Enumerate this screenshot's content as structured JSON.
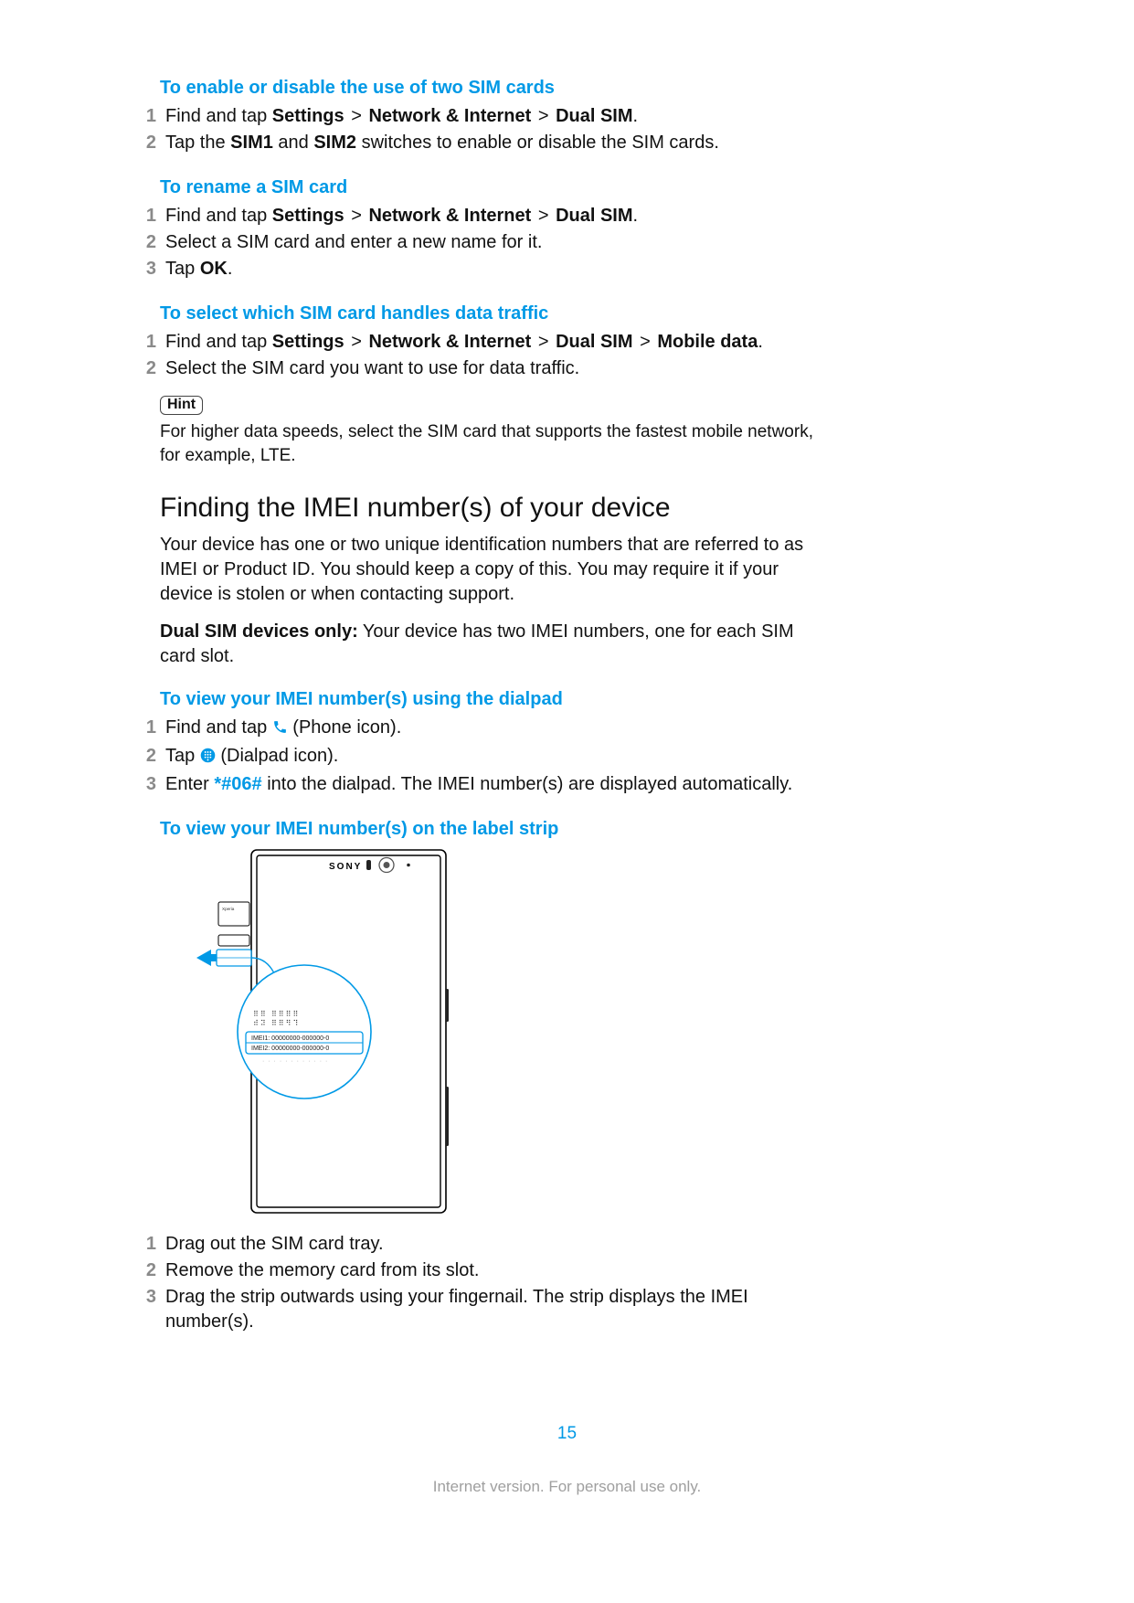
{
  "sections": [
    {
      "title": "To enable or disable the use of two SIM cards",
      "steps": [
        {
          "n": "1",
          "pre": "Find and tap ",
          "bold": [
            "Settings",
            "Network & Internet",
            "Dual SIM"
          ],
          "post": "."
        },
        {
          "n": "2",
          "plain_a": "Tap the ",
          "bold_a": "SIM1",
          "plain_b": " and ",
          "bold_b": "SIM2",
          "plain_c": " switches to enable or disable the SIM cards."
        }
      ]
    },
    {
      "title": "To rename a SIM card",
      "steps": [
        {
          "n": "1",
          "pre": "Find and tap ",
          "bold": [
            "Settings",
            "Network & Internet",
            "Dual SIM"
          ],
          "post": "."
        },
        {
          "n": "2",
          "plain": "Select a SIM card and enter a new name for it."
        },
        {
          "n": "3",
          "plain_a": "Tap ",
          "bold_a": "OK",
          "plain_b": "."
        }
      ]
    },
    {
      "title": "To select which SIM card handles data traffic",
      "steps": [
        {
          "n": "1",
          "pre": "Find and tap ",
          "bold": [
            "Settings",
            "Network & Internet",
            "Dual SIM",
            "Mobile data"
          ],
          "post": "."
        },
        {
          "n": "2",
          "plain": "Select the SIM card you want to use for data traffic."
        }
      ],
      "hint": {
        "label": "Hint",
        "text": "For higher data speeds, select the SIM card that supports the fastest mobile network, for example, LTE."
      }
    }
  ],
  "major_heading": "Finding the IMEI number(s) of your device",
  "para1": "Your device has one or two unique identification numbers that are referred to as IMEI or Product ID. You should keep a copy of this. You may require it if your device is stolen or when contacting support.",
  "para2_bold": "Dual SIM devices only:",
  "para2_rest": " Your device has two IMEI numbers, one for each SIM card slot.",
  "dialpad_section": {
    "title": "To view your IMEI number(s) using the dialpad",
    "steps": [
      {
        "n": "1",
        "a": "Find and tap ",
        "icon": "phone",
        "b": " (Phone icon)."
      },
      {
        "n": "2",
        "a": "Tap ",
        "icon": "dialpad",
        "b": " (Dialpad icon)."
      },
      {
        "n": "3",
        "a": "Enter ",
        "ussd": "*#06#",
        "b": " into the dialpad. The IMEI number(s) are displayed automatically."
      }
    ]
  },
  "labelstrip_section": {
    "title": "To view your IMEI number(s) on the label strip",
    "brand": "SONY",
    "imei1": "IMEI1: 00000000-000000-0",
    "imei2": "IMEI2: 00000000-000000-0",
    "steps": [
      {
        "n": "1",
        "plain": "Drag out the SIM card tray."
      },
      {
        "n": "2",
        "plain": "Remove the memory card from its slot."
      },
      {
        "n": "3",
        "plain": "Drag the strip outwards using your fingernail. The strip displays the IMEI number(s)."
      }
    ]
  },
  "page_number": "15",
  "footer": "Internet version. For personal use only."
}
